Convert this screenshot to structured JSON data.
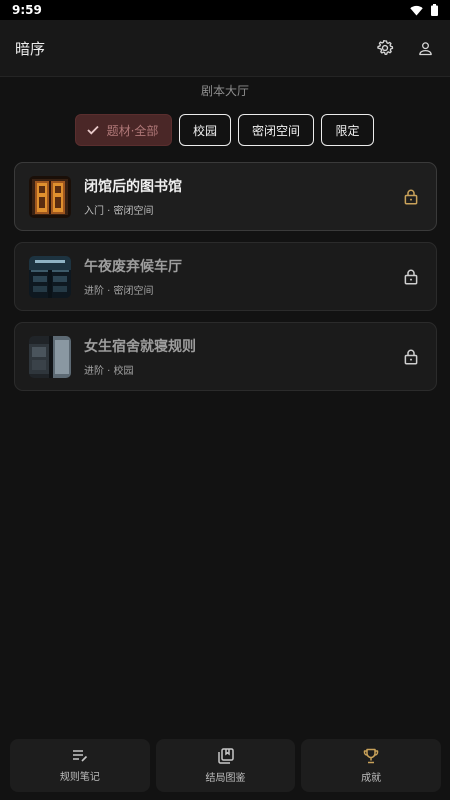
{
  "status": {
    "time": "9:59"
  },
  "app": {
    "title": "暗序"
  },
  "section": {
    "title": "剧本大厅"
  },
  "filters": [
    {
      "label": "题材·全部",
      "selected": true
    },
    {
      "label": "校园",
      "selected": false
    },
    {
      "label": "密闭空间",
      "selected": false
    },
    {
      "label": "限定",
      "selected": false
    }
  ],
  "scripts": [
    {
      "title": "闭馆后的图书馆",
      "meta": "入门 · 密闭空间",
      "locked": true,
      "thumb": "library-doors"
    },
    {
      "title": "午夜废弃候车厅",
      "meta": "进阶 · 密闭空间",
      "locked": true,
      "thumb": "waiting-hall"
    },
    {
      "title": "女生宿舍就寝规则",
      "meta": "进阶 · 校园",
      "locked": true,
      "thumb": "dorm-room"
    }
  ],
  "nav": [
    {
      "label": "规则笔记",
      "icon": "notes-icon"
    },
    {
      "label": "结局图鉴",
      "icon": "collection-icon"
    },
    {
      "label": "成就",
      "icon": "trophy-icon"
    }
  ],
  "colors": {
    "background": "#121212",
    "selected_chip": "#4a2727",
    "selected_text": "#b07878",
    "lock_gold": "#c9a25a"
  }
}
